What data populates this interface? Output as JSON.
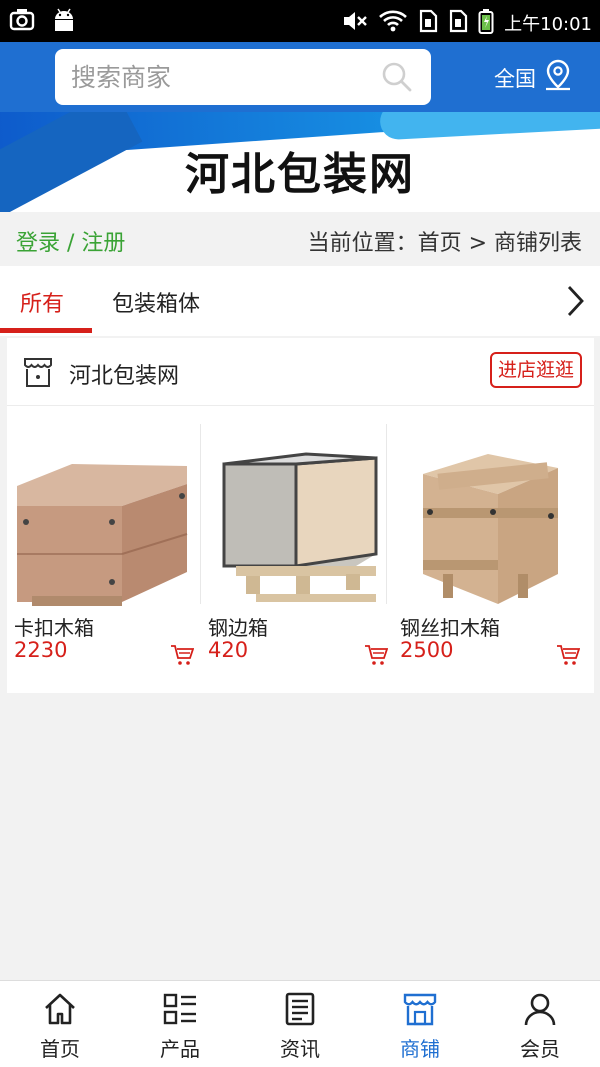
{
  "status_bar": {
    "time": "上午10:01",
    "icons": [
      "camera-icon",
      "android-icon",
      "mute-icon",
      "wifi-icon",
      "sim-icon",
      "sim-icon",
      "battery-icon"
    ]
  },
  "header": {
    "search_placeholder": "搜索商家",
    "region_label": "全国",
    "colors": {
      "header_bg": "#1f6fd1"
    }
  },
  "banner": {
    "title": "河北包装网"
  },
  "login_bar": {
    "login_label": "登录 / 注册",
    "breadcrumb": "当前位置：首页 > 商铺列表"
  },
  "tabs": [
    {
      "label": "所有",
      "active": true
    },
    {
      "label": "包装箱体",
      "active": false
    }
  ],
  "shop": {
    "name": "河北包装网",
    "visit_button": "进店逛逛",
    "products": [
      {
        "name": "卡扣木箱",
        "price": "2230",
        "icon": "cart-icon"
      },
      {
        "name": "钢边箱",
        "price": "420",
        "icon": "cart-icon"
      },
      {
        "name": "钢丝扣木箱",
        "price": "2500",
        "icon": "cart-icon"
      }
    ]
  },
  "bottom_nav": [
    {
      "label": "首页",
      "icon": "home-icon",
      "active": false
    },
    {
      "label": "产品",
      "icon": "grid-list-icon",
      "active": false
    },
    {
      "label": "资讯",
      "icon": "news-icon",
      "active": false
    },
    {
      "label": "商铺",
      "icon": "shop-icon",
      "active": true
    },
    {
      "label": "会员",
      "icon": "user-icon",
      "active": false
    }
  ],
  "accent_color": "#d6201a",
  "active_nav_color": "#1f6fd1"
}
